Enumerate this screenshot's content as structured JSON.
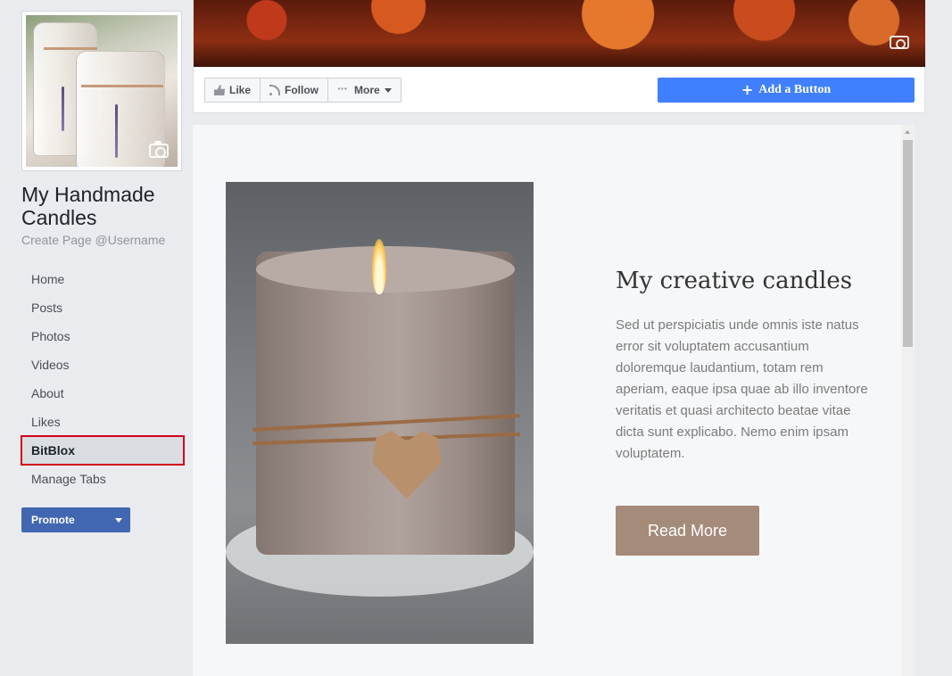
{
  "sidebar": {
    "page_name": "My Handmade Candles",
    "username": "Create Page @Username",
    "nav_items": [
      {
        "label": "Home"
      },
      {
        "label": "Posts"
      },
      {
        "label": "Photos"
      },
      {
        "label": "Videos"
      },
      {
        "label": "About"
      },
      {
        "label": "Likes"
      },
      {
        "label": "BitBlox",
        "active": true
      },
      {
        "label": "Manage Tabs"
      }
    ],
    "promote_label": "Promote"
  },
  "header": {
    "actions": {
      "like_label": "Like",
      "follow_label": "Follow",
      "more_label": "More"
    },
    "add_button_label": "Add a Button",
    "accent_color": "#4080ff"
  },
  "content": {
    "headline": "My creative candles",
    "body": "Sed ut perspiciatis unde omnis iste natus error sit voluptatem accusantium doloremque laudantium, totam rem aperiam, eaque ipsa quae ab illo inventore veritatis et quasi architecto beatae vitae dicta sunt explicabo. Nemo enim ipsam voluptatem.",
    "read_more_label": "Read More",
    "button_color": "#a58b7a"
  }
}
